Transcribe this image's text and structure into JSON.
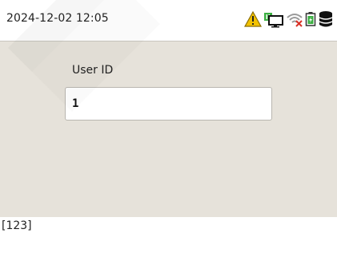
{
  "status_bar": {
    "datetime": "2024-12-02 12:05",
    "icons": [
      "warning-icon",
      "network-monitor-icon",
      "wifi-disconnected-icon",
      "battery-charging-icon",
      "database-icon"
    ]
  },
  "form": {
    "user_id_label": "User ID",
    "user_id_value": "1"
  },
  "footer": {
    "input_mode": "[123]"
  },
  "colors": {
    "panel_background": "#e6e2da",
    "warning": "#f2c200",
    "network_green": "#3cb043",
    "wifi_gray": "#9a9a9a",
    "wifi_error": "#d93025"
  }
}
